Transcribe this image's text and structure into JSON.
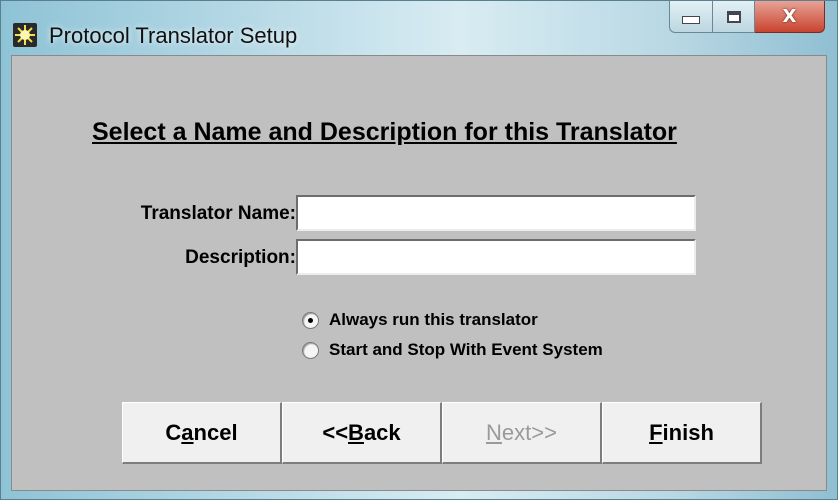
{
  "window": {
    "title": "Protocol Translator Setup",
    "icon": "sunburst-app-icon",
    "caption_buttons": {
      "minimize_icon": "minimize-icon",
      "maximize_icon": "maximize-icon",
      "close_glyph": "X"
    }
  },
  "content": {
    "heading": "Select a Name and Description for this Translator",
    "fields": {
      "name_label": "Translator Name:",
      "name_value": "",
      "description_label": "Description:",
      "description_value": ""
    },
    "run_mode": {
      "options": [
        {
          "label": "Always run this translator",
          "checked": true
        },
        {
          "label": "Start and Stop With Event System",
          "checked": false
        }
      ]
    }
  },
  "buttons": {
    "cancel": {
      "pre": "C",
      "mnemonic": "a",
      "post": "ncel"
    },
    "back": {
      "pre": "<<",
      "mnemonic": "B",
      "post": "ack"
    },
    "next": {
      "pre": "",
      "mnemonic": "N",
      "post": "ext>>",
      "enabled": false
    },
    "finish": {
      "pre": "",
      "mnemonic": "F",
      "post": "inish"
    }
  }
}
